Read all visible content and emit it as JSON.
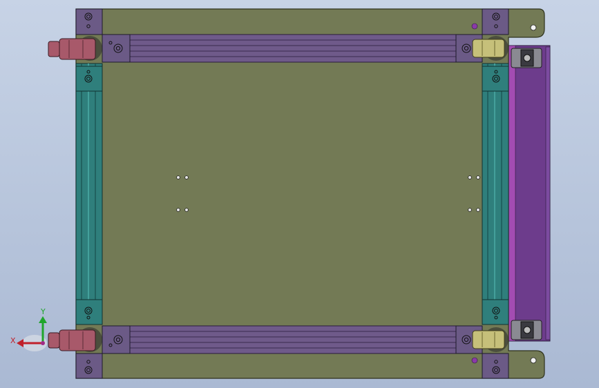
{
  "view": {
    "background_top": "#c7d3e6",
    "background_bottom": "#aab9d3"
  },
  "colors": {
    "plate": "#737a55",
    "plate_edge": "#2e321c",
    "rail": "#6f5a8a",
    "rail_dark": "#4f3d66",
    "side_rail": "#2f7f7c",
    "side_rail_light": "#44a09b",
    "bracket": "#6b5a86",
    "caster_red": "#a8596a",
    "caster_yellow": "#c6c07a",
    "handle_purple": "#6d3c8c",
    "hinge_gray": "#8a8a92"
  },
  "triad": {
    "x_label": "X",
    "y_label": "Y",
    "x_color": "#c0202a",
    "y_color": "#1fa52b",
    "origin_color": "#a02b86"
  },
  "model": {
    "name": "cart-frame-top-view",
    "casters": [
      {
        "id": "top-left",
        "color": "red"
      },
      {
        "id": "bottom-left",
        "color": "red"
      },
      {
        "id": "top-right",
        "color": "yellow"
      },
      {
        "id": "bottom-right",
        "color": "yellow"
      }
    ]
  }
}
